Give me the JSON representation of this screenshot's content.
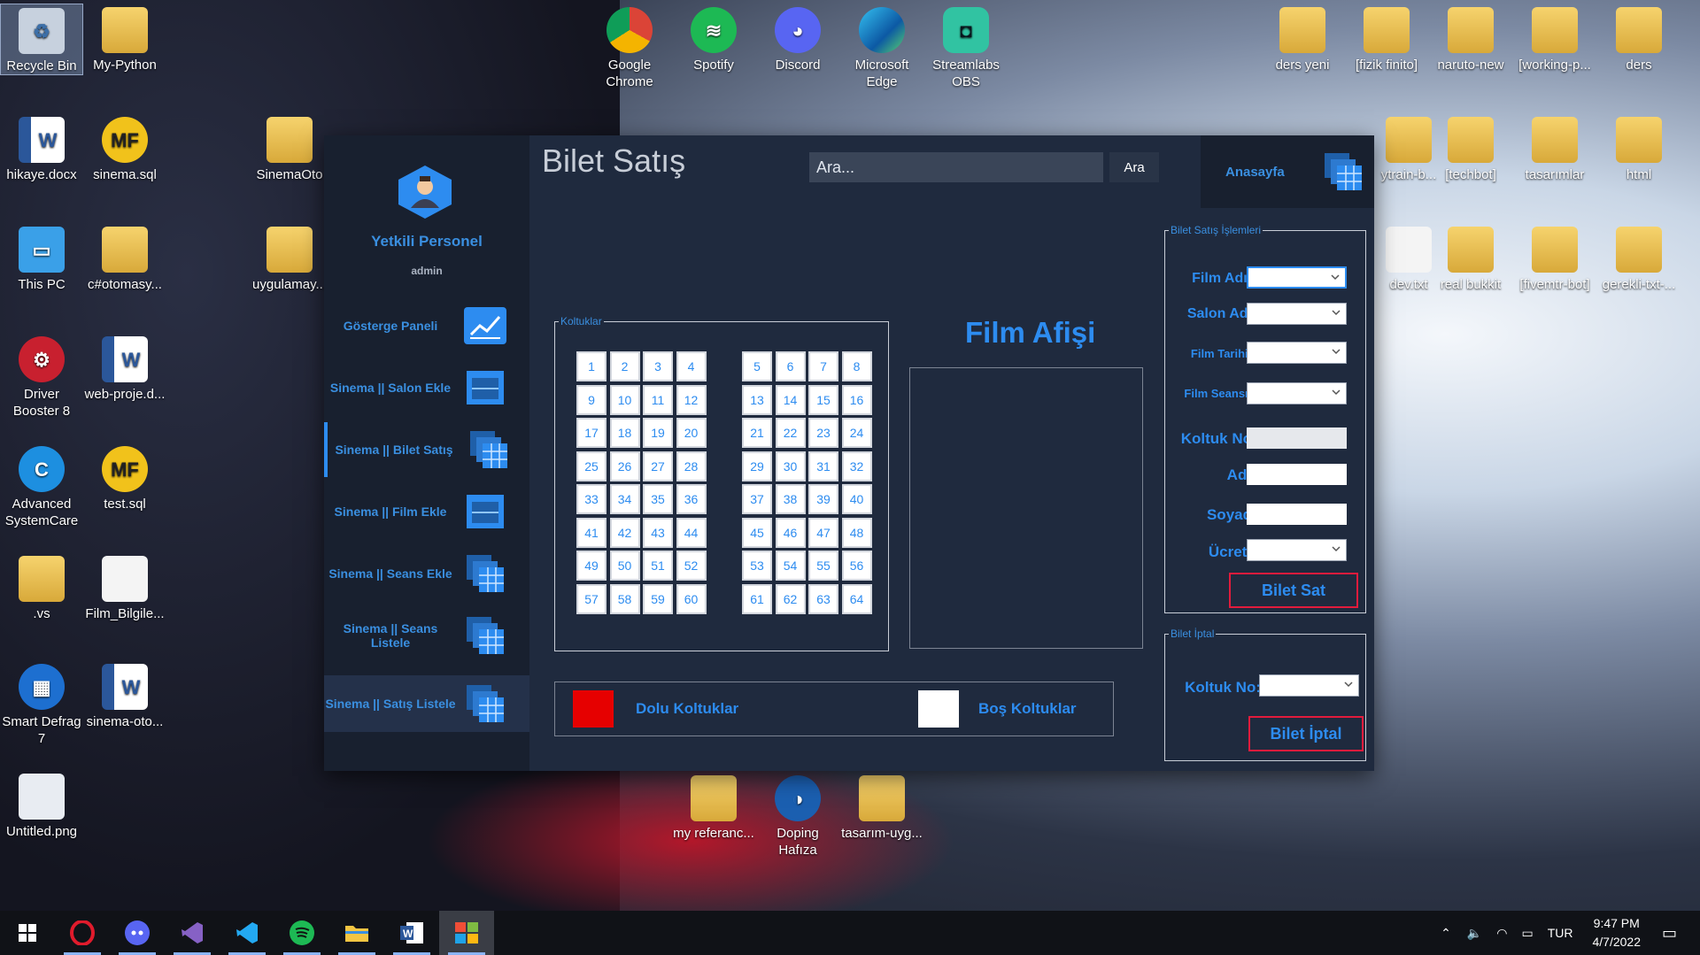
{
  "desktop": {
    "icons_left": [
      {
        "label": "Recycle Bin",
        "icon": "recycle-bin-icon"
      },
      {
        "label": "My-Python",
        "icon": "folder-icon"
      },
      {
        "label": "hikaye.docx",
        "icon": "word-doc-icon"
      },
      {
        "label": "sinema.sql",
        "icon": "mf-sql-icon"
      },
      {
        "label": "SinemaOto",
        "icon": "folder-icon"
      },
      {
        "label": "This PC",
        "icon": "pc-icon"
      },
      {
        "label": "c#otomasy...",
        "icon": "folder-icon"
      },
      {
        "label": "uygulamay...",
        "icon": "folder-icon"
      },
      {
        "label": "Driver Booster 8",
        "icon": "driver-booster-icon"
      },
      {
        "label": "web-proje.d...",
        "icon": "word-doc-icon"
      },
      {
        "label": "Advanced SystemCare",
        "icon": "advanced-systemcare-icon"
      },
      {
        "label": "test.sql",
        "icon": "mf-sql-icon"
      },
      {
        "label": ".vs",
        "icon": "folder-icon"
      },
      {
        "label": "Film_Bilgile...",
        "icon": "file-icon"
      },
      {
        "label": "Smart Defrag 7",
        "icon": "smart-defrag-icon"
      },
      {
        "label": "sinema-oto...",
        "icon": "word-doc-icon"
      },
      {
        "label": "Untitled.png",
        "icon": "image-file-icon"
      }
    ],
    "icons_top": [
      {
        "label": "Google Chrome",
        "icon": "chrome-icon"
      },
      {
        "label": "Spotify",
        "icon": "spotify-icon"
      },
      {
        "label": "Discord",
        "icon": "discord-icon"
      },
      {
        "label": "Microsoft Edge",
        "icon": "edge-icon"
      },
      {
        "label": "Streamlabs OBS",
        "icon": "streamlabs-icon"
      }
    ],
    "icons_right": [
      {
        "label": "ders yeni",
        "icon": "folder-icon"
      },
      {
        "label": "[fizik finito]",
        "icon": "folder-icon"
      },
      {
        "label": "naruto-new",
        "icon": "folder-icon"
      },
      {
        "label": "[working-p...",
        "icon": "folder-icon"
      },
      {
        "label": "ders",
        "icon": "folder-icon"
      },
      {
        "label": "ytrain-b...",
        "icon": "folder-icon"
      },
      {
        "label": "[techbot]",
        "icon": "folder-icon"
      },
      {
        "label": "tasarımlar",
        "icon": "folder-icon"
      },
      {
        "label": "html",
        "icon": "folder-icon"
      },
      {
        "label": "dev.txt",
        "icon": "file-icon"
      },
      {
        "label": "real bukkit",
        "icon": "folder-icon"
      },
      {
        "label": "[fivemtr-bot]",
        "icon": "folder-icon"
      },
      {
        "label": "gerekli-txt-...",
        "icon": "folder-icon"
      }
    ],
    "icons_bottom": [
      {
        "label": "my referanc...",
        "icon": "folder-icon"
      },
      {
        "label": "Doping Hafıza",
        "icon": "doping-hafiza-icon"
      },
      {
        "label": "tasarım-uyg...",
        "icon": "folder-icon"
      }
    ]
  },
  "app": {
    "sidebar": {
      "user_title": "Yetkili Personel",
      "user_role": "admin",
      "items": [
        {
          "label": "Gösterge Paneli",
          "icon": "chart-icon"
        },
        {
          "label": "Sinema || Salon Ekle",
          "icon": "window-icon"
        },
        {
          "label": "Sinema || Bilet Satış",
          "icon": "stack-icon"
        },
        {
          "label": "Sinema || Film Ekle",
          "icon": "window-icon"
        },
        {
          "label": "Sinema || Seans Ekle",
          "icon": "stack-icon"
        },
        {
          "label": "Sinema || Seans Listele",
          "icon": "stack-icon"
        },
        {
          "label": "Sinema || Satış Listele",
          "icon": "stack-icon"
        }
      ]
    },
    "header": {
      "title": "Bilet Satış",
      "search_placeholder": "Ara...",
      "search_button": "Ara",
      "home_label": "Anasayfa"
    },
    "seats": {
      "group_label": "Koltuklar",
      "left_block": [
        1,
        2,
        3,
        4,
        9,
        10,
        11,
        12,
        17,
        18,
        19,
        20,
        25,
        26,
        27,
        28,
        33,
        34,
        35,
        36,
        41,
        42,
        43,
        44,
        49,
        50,
        51,
        52,
        57,
        58,
        59,
        60
      ],
      "right_block": [
        5,
        6,
        7,
        8,
        13,
        14,
        15,
        16,
        21,
        22,
        23,
        24,
        29,
        30,
        31,
        32,
        37,
        38,
        39,
        40,
        45,
        46,
        47,
        48,
        53,
        54,
        55,
        56,
        61,
        62,
        63,
        64
      ]
    },
    "poster": {
      "title": "Film Afişi"
    },
    "legend": {
      "occupied_label": "Dolu Koltuklar",
      "occupied_color": "#e60000",
      "empty_label": "Boş Koltuklar",
      "empty_color": "#ffffff"
    },
    "sale_form": {
      "group_label": "Bilet Satış İşlemleri",
      "film_name_label": "Film Adı:",
      "hall_name_label": "Salon Adı",
      "film_date_label": "Film Tarihi:",
      "session_label": "Film Seansı:",
      "seat_no_label": "Koltuk No",
      "first_name_label": "Ad:",
      "last_name_label": "Soyad",
      "price_label": "Ücret:",
      "sell_button": "Bilet Sat"
    },
    "cancel_form": {
      "group_label": "Bilet İptal",
      "seat_no_label": "Koltuk No:",
      "cancel_button": "Bilet İptal"
    },
    "accent_color": "#2d8cf0",
    "button_border_color": "#e21b3c"
  },
  "taskbar": {
    "apps": [
      "start-icon",
      "opera-icon",
      "discord-icon",
      "visual-studio-icon",
      "vscode-icon",
      "spotify-icon",
      "file-explorer-icon",
      "word-icon",
      "app-window-icon"
    ],
    "language": "TUR",
    "time": "9:47 PM",
    "date": "4/7/2022"
  }
}
